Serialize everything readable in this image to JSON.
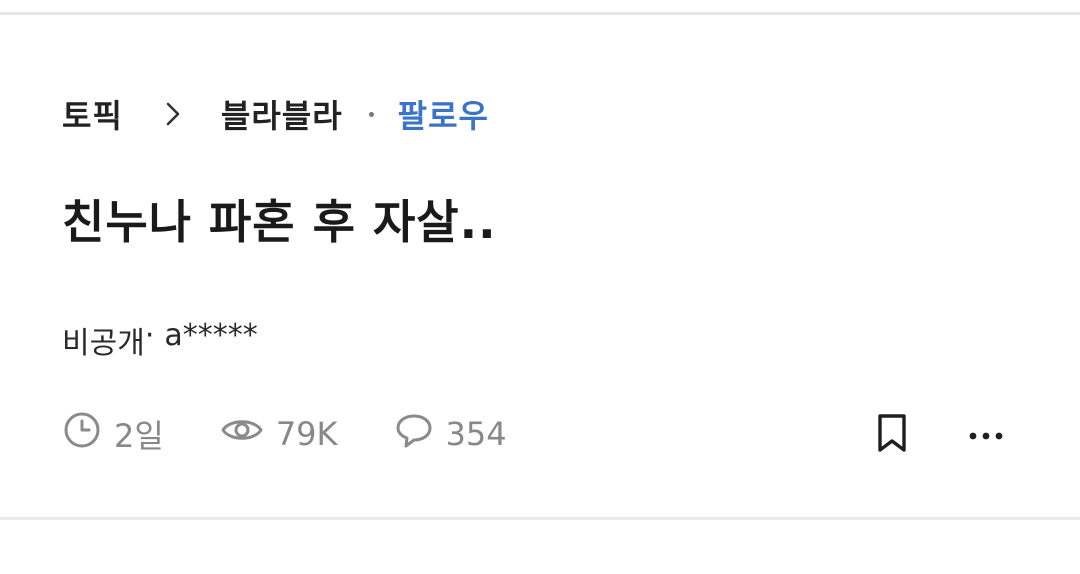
{
  "breadcrumb": {
    "topic": "토픽",
    "board": "블라블라",
    "follow": "팔로우"
  },
  "post": {
    "title": "친누나 파혼 후 자살..",
    "company": "비공개",
    "separator": "·",
    "author": "a*****"
  },
  "stats": {
    "time": "2일",
    "views": "79K",
    "comments": "354"
  },
  "colors": {
    "accent": "#3a73c9",
    "muted": "#888888"
  },
  "icons": [
    "chevron-right-icon",
    "clock-icon",
    "eye-icon",
    "comment-icon",
    "bookmark-icon",
    "more-icon"
  ]
}
